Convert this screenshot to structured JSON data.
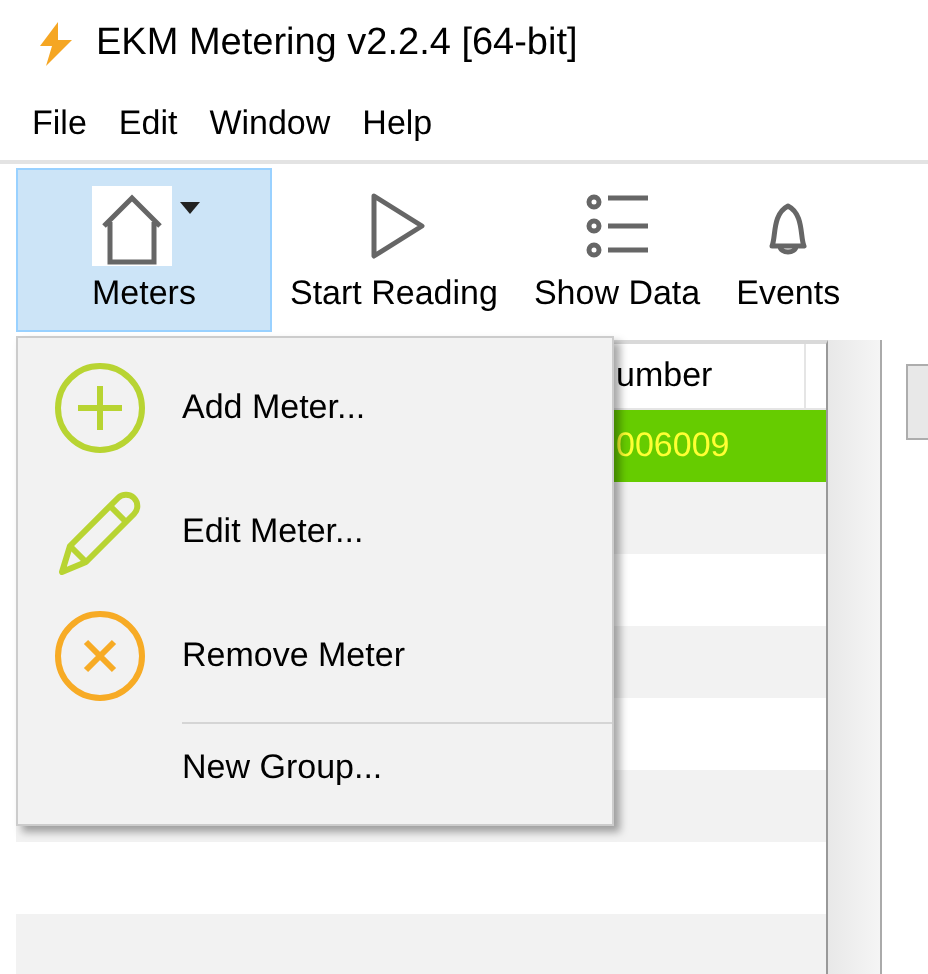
{
  "window": {
    "title": "EKM Metering v2.2.4 [64-bit]"
  },
  "menu_bar": [
    "File",
    "Edit",
    "Window",
    "Help"
  ],
  "toolbar": [
    {
      "kind": "meters",
      "label": "Meters",
      "selected": true
    },
    {
      "kind": "start",
      "label": "Start Reading",
      "selected": false
    },
    {
      "kind": "data",
      "label": "Show Data",
      "selected": false
    },
    {
      "kind": "events",
      "label": "Events",
      "selected": false
    }
  ],
  "table": {
    "columns": [
      "umber"
    ],
    "rows": [
      {
        "cell": "006009",
        "selected": true
      },
      {
        "selected": false
      },
      {
        "selected": false
      },
      {
        "selected": false
      },
      {
        "selected": false
      },
      {
        "selected": false
      },
      {
        "selected": false
      },
      {
        "selected": false
      }
    ]
  },
  "dropdown": [
    {
      "kind": "add",
      "label": "Add Meter..."
    },
    {
      "kind": "edit",
      "label": "Edit Meter..."
    },
    {
      "kind": "remove",
      "label": "Remove Meter"
    },
    {
      "kind": "separator"
    },
    {
      "kind": "plain",
      "label": "New Group..."
    }
  ]
}
